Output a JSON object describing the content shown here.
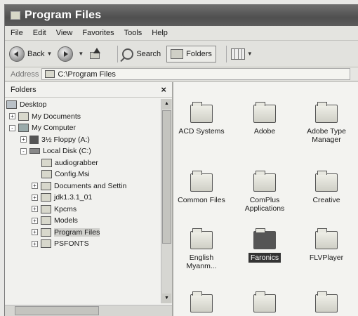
{
  "window": {
    "title": "Program Files"
  },
  "menu": [
    "File",
    "Edit",
    "View",
    "Favorites",
    "Tools",
    "Help"
  ],
  "toolbar": {
    "back": "Back",
    "search": "Search",
    "folders": "Folders"
  },
  "address": {
    "label": "Address",
    "value": "C:\\Program Files"
  },
  "tree": {
    "header": "Folders",
    "items": [
      {
        "label": "Desktop",
        "exp": ""
      },
      {
        "label": "My Documents",
        "exp": "+"
      },
      {
        "label": "My Computer",
        "exp": "-"
      },
      {
        "label": "3½ Floppy (A:)",
        "exp": "+"
      },
      {
        "label": "Local Disk (C:)",
        "exp": "-"
      },
      {
        "label": "audiograbber",
        "exp": ""
      },
      {
        "label": "Config.Msi",
        "exp": ""
      },
      {
        "label": "Documents and Settin",
        "exp": "+"
      },
      {
        "label": "jdk1.3.1_01",
        "exp": "+"
      },
      {
        "label": "Kpcms",
        "exp": "+"
      },
      {
        "label": "Models",
        "exp": "+"
      },
      {
        "label": "Program Files",
        "exp": "+"
      },
      {
        "label": "PSFONTS",
        "exp": "+"
      }
    ]
  },
  "files": [
    {
      "name": "ACD Systems"
    },
    {
      "name": "Adobe"
    },
    {
      "name": "Adobe Type Manager"
    },
    {
      "name": "Common Files"
    },
    {
      "name": "ComPlus Applications"
    },
    {
      "name": "Creative"
    },
    {
      "name": "English Myanm..."
    },
    {
      "name": "Faronics",
      "selected": true
    },
    {
      "name": "FLVPlayer"
    },
    {
      "name": ""
    },
    {
      "name": ""
    },
    {
      "name": ""
    }
  ]
}
